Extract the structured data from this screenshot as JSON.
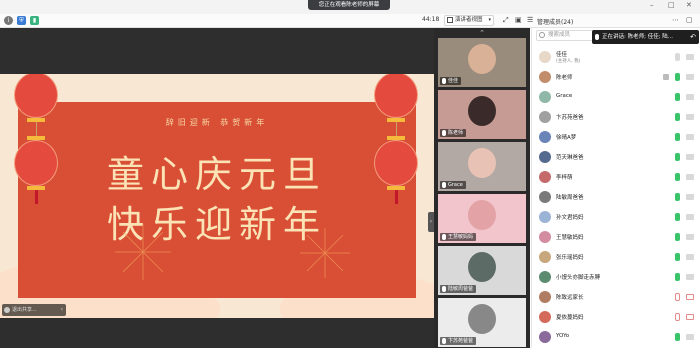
{
  "window": {
    "share_banner": "您正在观看陈老师的屏幕",
    "controls": [
      "–",
      "□",
      "✕"
    ]
  },
  "toolbar": {
    "left_icons": [
      "info-icon",
      "shield-icon",
      "signal-icon"
    ],
    "timer": "44:18",
    "view_button": "演讲者视图",
    "right_icons": [
      "fullscreen-icon",
      "layout-icon",
      "list-icon"
    ],
    "member_title": "管理成员(24)",
    "more": "⋯"
  },
  "slide": {
    "subtitle": "辞旧迎新 恭贺新年",
    "line1": "童心庆元旦",
    "line2": "快乐迎新年",
    "control_label": "退出共享..."
  },
  "tiles": [
    {
      "name": "佳佳",
      "bg": "#9a8c7c",
      "face": "#d8b197"
    },
    {
      "name": "陈老师",
      "bg": "#c59b94",
      "face": "#3a2b2a"
    },
    {
      "name": "Grace",
      "bg": "#b3a9a4",
      "face": "#e8c2b5"
    },
    {
      "name": "王慧敏妈妈",
      "bg": "#f2c5cc",
      "face": "#e3a3a6"
    },
    {
      "name": "陆敏周爸爸",
      "bg": "#d9d9d9",
      "face": "#5d6b66"
    },
    {
      "name": "卞苏苑爸爸",
      "bg": "#ececec",
      "face": "#888"
    }
  ],
  "members": {
    "search_placeholder": "搜索成员",
    "speaking": "正在讲话: 陈老师; 佳佳; 陆...",
    "list": [
      {
        "name": "佳佳",
        "sub": "(主持人, 我)",
        "avatar": "#e8d8c8",
        "mic": "muted",
        "cam": "muted"
      },
      {
        "name": "陈老师",
        "sub": "",
        "avatar": "#c28d6a",
        "mic": "on",
        "cam": "muted",
        "shield": true
      },
      {
        "name": "Grace",
        "sub": "",
        "avatar": "#8fb8a8",
        "mic": "on",
        "cam": "muted"
      },
      {
        "name": "卞苏苑爸爸",
        "sub": "",
        "avatar": "#a0a0a0",
        "mic": "on",
        "cam": "muted"
      },
      {
        "name": "徐晴A梦",
        "sub": "",
        "avatar": "#6a84b8",
        "mic": "on",
        "cam": "muted"
      },
      {
        "name": "范天琳爸爸",
        "sub": "",
        "avatar": "#556a8f",
        "mic": "on",
        "cam": "muted"
      },
      {
        "name": "李梓萌",
        "sub": "",
        "avatar": "#c46a6a",
        "mic": "on",
        "cam": "muted"
      },
      {
        "name": "陆敏周爸爸",
        "sub": "",
        "avatar": "#7a7a7a",
        "mic": "on",
        "cam": "muted"
      },
      {
        "name": "孙文君妈妈",
        "sub": "",
        "avatar": "#9bb3d4",
        "mic": "on",
        "cam": "muted"
      },
      {
        "name": "王慧敏妈妈",
        "sub": "",
        "avatar": "#d48ca0",
        "mic": "on",
        "cam": "muted"
      },
      {
        "name": "张乐瑶妈妈",
        "sub": "",
        "avatar": "#c9a77c",
        "mic": "on",
        "cam": "muted"
      },
      {
        "name": "小馒头亦脚走赤膊",
        "sub": "",
        "avatar": "#5c8c70",
        "mic": "on",
        "cam": "muted"
      },
      {
        "name": "陈致远家长",
        "sub": "",
        "avatar": "#b07d62",
        "mic": "off",
        "cam": "off"
      },
      {
        "name": "夏依蔓妈妈",
        "sub": "",
        "avatar": "#d46a5a",
        "mic": "off",
        "cam": "off"
      },
      {
        "name": "YOYo",
        "sub": "",
        "avatar": "#8a6a9a",
        "mic": "on",
        "cam": "muted"
      }
    ]
  },
  "colors": {
    "card_red": "#d94f36",
    "slide_bg": "#f7e7d3",
    "gold_text": "#fbe3b6",
    "mic_green": "#39c46a"
  }
}
